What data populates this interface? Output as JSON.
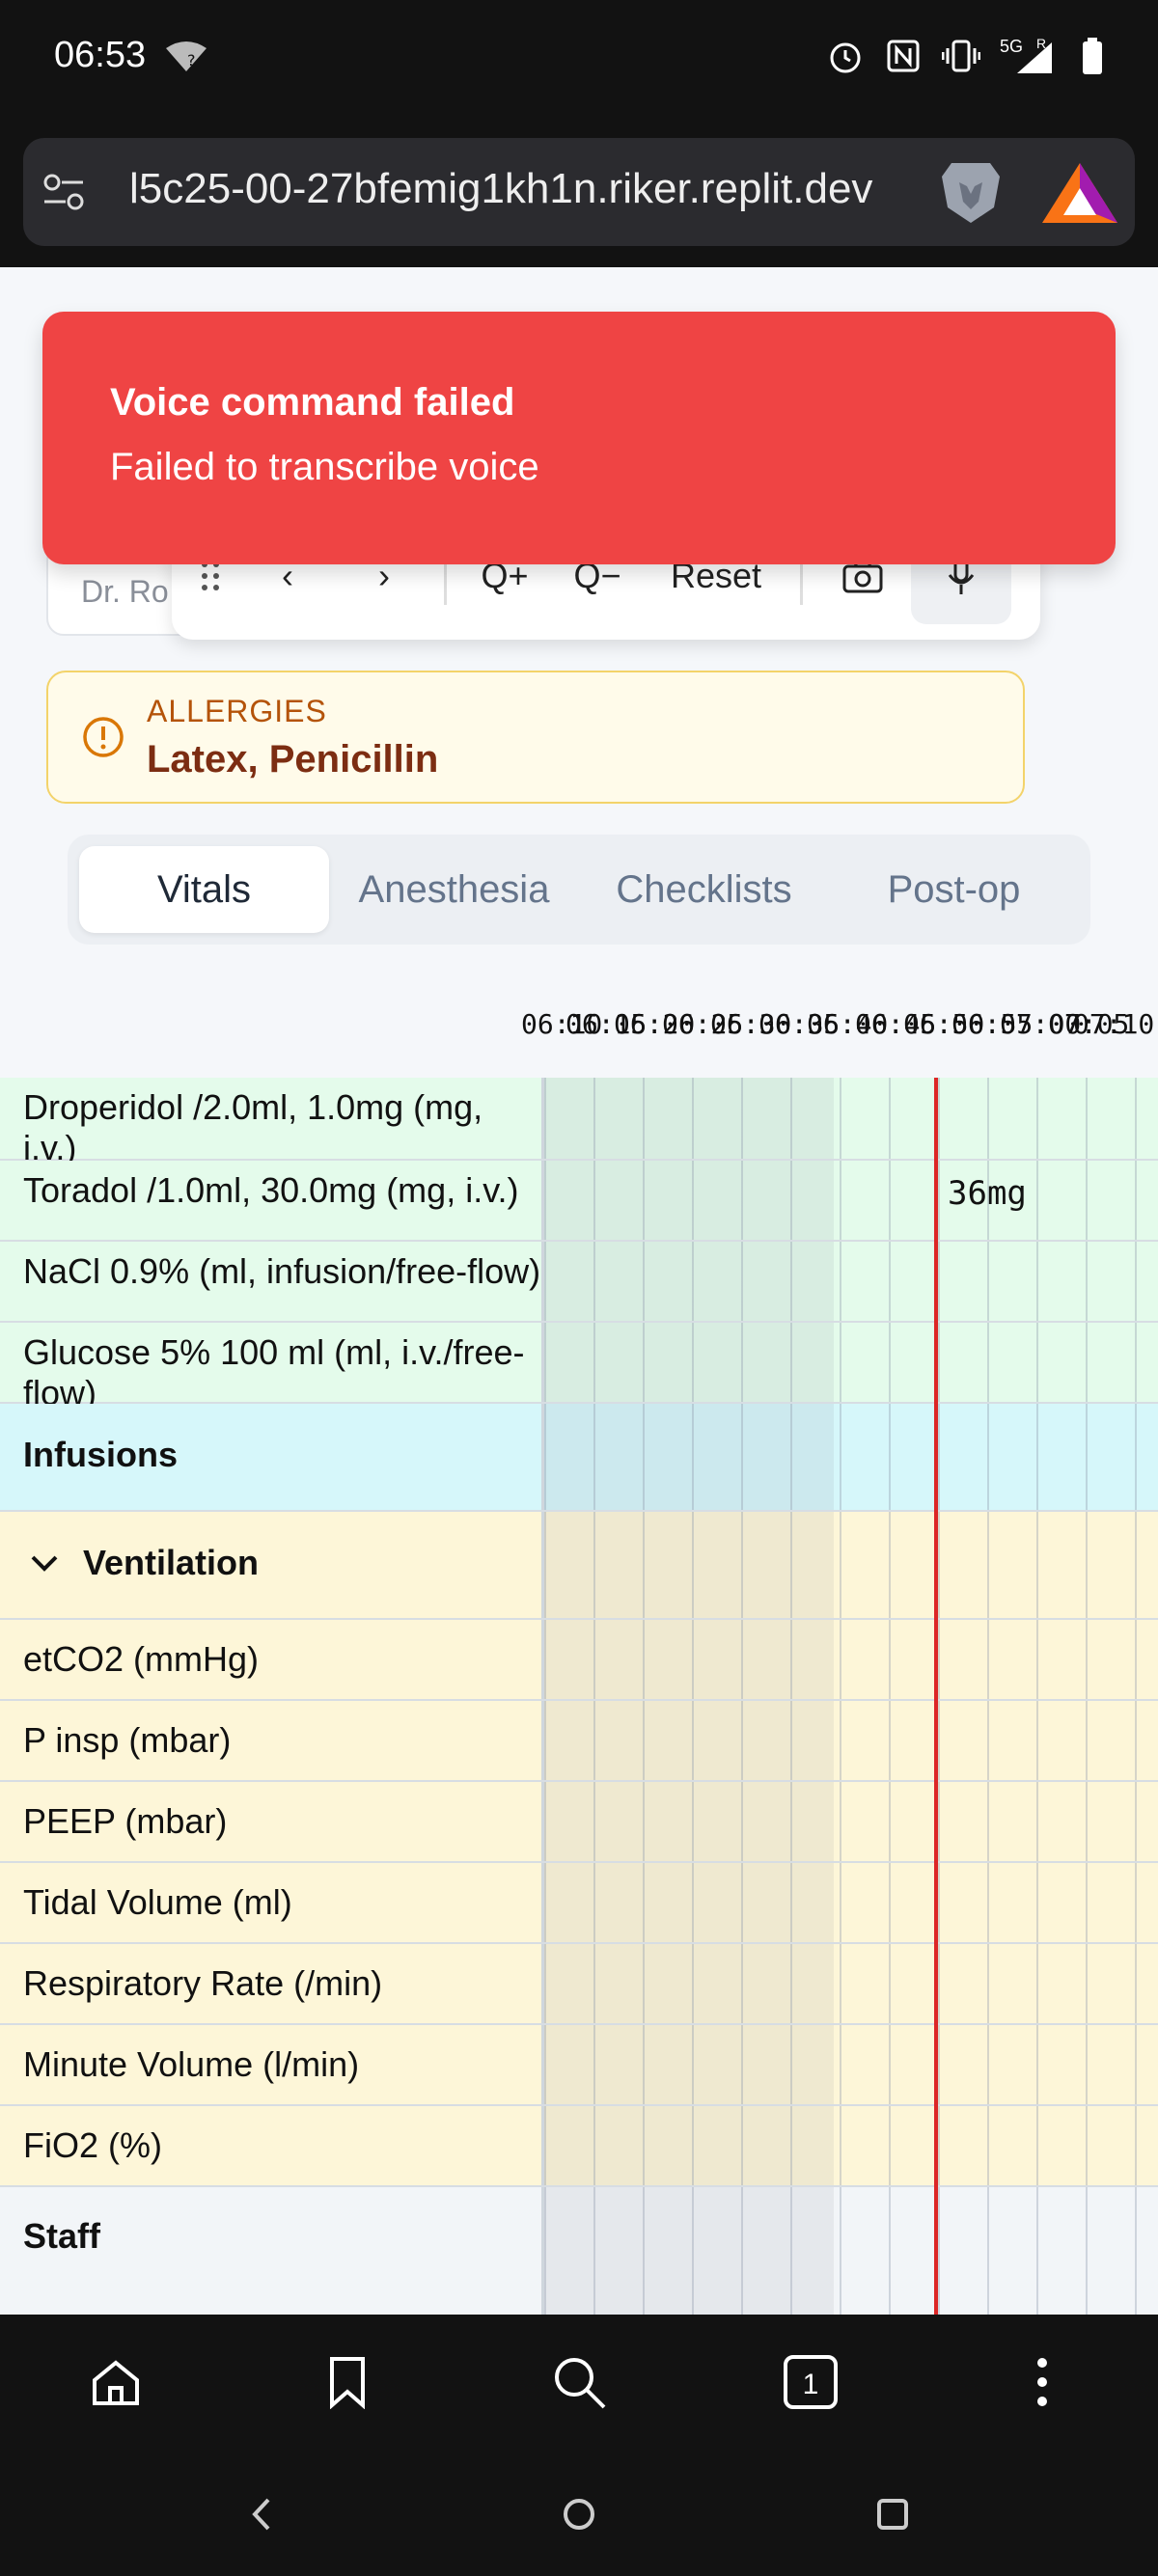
{
  "status_bar": {
    "time": "06:53",
    "wifi_badge": "?",
    "network": "5G",
    "roaming": "R",
    "icons": [
      "alarm-icon",
      "nfc-icon",
      "vibrate-icon",
      "signal-icon",
      "battery-icon"
    ]
  },
  "browser": {
    "url": "l5c25-00-27bfemig1kh1n.riker.replit.dev",
    "icons": [
      "site-settings-icon",
      "brave-shields-icon",
      "brave-rewards-icon"
    ]
  },
  "toast": {
    "title": "Voice command failed",
    "message": "Failed to transcribe voice",
    "color": "#ef4444"
  },
  "doctor_chip": "Dr. Ro",
  "toolbar": {
    "prev": "‹",
    "next": "›",
    "zoom_in": "Q+",
    "zoom_out": "Q−",
    "reset": "Reset"
  },
  "allergies": {
    "label": "ALLERGIES",
    "value": "Latex, Penicillin"
  },
  "tabs": [
    {
      "label": "Vitals",
      "active": true
    },
    {
      "label": "Anesthesia",
      "active": false
    },
    {
      "label": "Checklists",
      "active": false
    },
    {
      "label": "Post-op",
      "active": false
    }
  ],
  "time_axis": [
    "06:10",
    "06:15",
    "06:20",
    "06:25",
    "06:30",
    "06:35",
    "06:40",
    "06:45",
    "06:50",
    "06:55",
    "07:00",
    "07:05",
    "07:10"
  ],
  "rows": {
    "droperidol": "Droperidol /2.0ml, 1.0mg (mg, i.v.)",
    "toradol": "Toradol /1.0ml, 30.0mg (mg, i.v.)",
    "toradol_dose": "36mg",
    "nacl": "NaCl 0.9% (ml, infusion/free-flow)",
    "glucose": "Glucose 5% 100 ml (ml, i.v./free-flow)",
    "infusions": "Infusions",
    "ventilation": "Ventilation",
    "etco2": "etCO2 (mmHg)",
    "pinsp": "P insp (mbar)",
    "peep": "PEEP (mbar)",
    "tidal": "Tidal Volume (ml)",
    "rr": "Respiratory Rate (/min)",
    "mv": "Minute Volume (l/min)",
    "fio2": "FiO2 (%)",
    "staff": "Staff"
  },
  "colors": {
    "medication_row": "#e4fbeb",
    "infusions_row": "#d6f7fa",
    "ventilation_row": "#fdf6d8",
    "staff_row": "#f2f5f8",
    "now_line": "#dc2626"
  }
}
